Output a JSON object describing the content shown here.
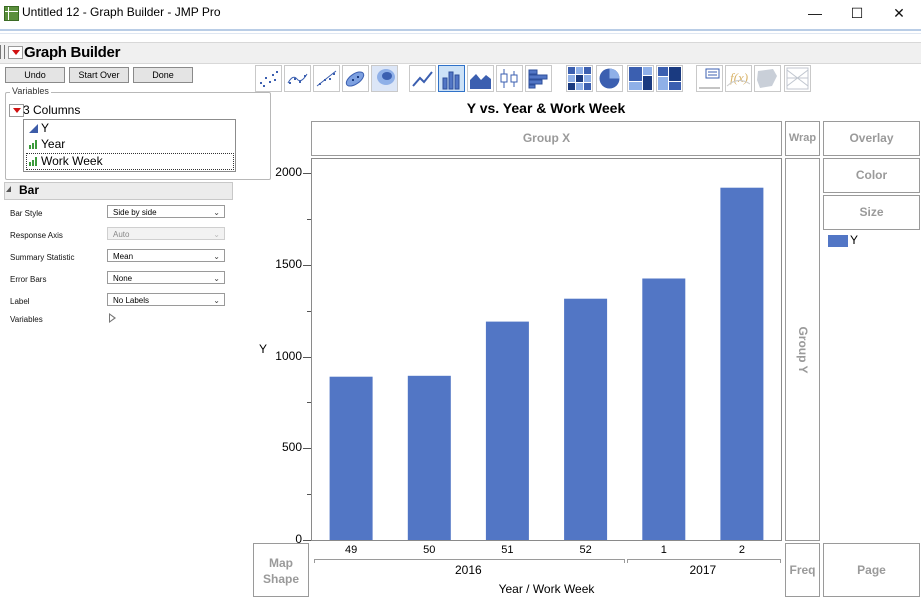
{
  "window": {
    "title": "Untitled 12 - Graph Builder - JMP Pro",
    "minimize": "—",
    "maximize": "☐",
    "close": "✕"
  },
  "header": {
    "title": "Graph Builder"
  },
  "buttons": {
    "undo": "Undo",
    "start_over": "Start Over",
    "done": "Done"
  },
  "variables": {
    "legend": "Variables",
    "columns_label": "3 Columns",
    "columns": [
      {
        "name": "Y",
        "type": "continuous"
      },
      {
        "name": "Year",
        "type": "ordinal"
      },
      {
        "name": "Work Week",
        "type": "ordinal"
      }
    ]
  },
  "bar_panel": {
    "title": "Bar",
    "props": [
      {
        "label": "Bar Style",
        "value": "Side by side",
        "enabled": true
      },
      {
        "label": "Response Axis",
        "value": "Auto",
        "enabled": false
      },
      {
        "label": "Summary Statistic",
        "value": "Mean",
        "enabled": true
      },
      {
        "label": "Error Bars",
        "value": "None",
        "enabled": true
      },
      {
        "label": "Label",
        "value": "No Labels",
        "enabled": true
      }
    ],
    "variables_label": "Variables"
  },
  "zones": {
    "group_x": "Group X",
    "group_y": "Group Y",
    "wrap": "Wrap",
    "overlay": "Overlay",
    "color": "Color",
    "size": "Size",
    "map_shape": "Map Shape",
    "freq": "Freq",
    "page": "Page"
  },
  "legend": {
    "label": "Y",
    "color": "#5276c5"
  },
  "chart_data": {
    "type": "bar",
    "title": "Y vs. Year & Work Week",
    "ylabel": "Y",
    "xlabel": "Year / Work Week",
    "ylim": [
      0,
      2000
    ],
    "yticks": [
      0,
      500,
      1000,
      1500,
      2000
    ],
    "categories": [
      "49",
      "50",
      "51",
      "52",
      "1",
      "2"
    ],
    "groups": [
      {
        "label": "2016",
        "members": [
          "49",
          "50",
          "51",
          "52"
        ]
      },
      {
        "label": "2017",
        "members": [
          "1",
          "2"
        ]
      }
    ],
    "series": [
      {
        "name": "Y",
        "values": [
          890,
          895,
          1190,
          1315,
          1425,
          1920
        ],
        "color": "#5276c5"
      }
    ]
  }
}
